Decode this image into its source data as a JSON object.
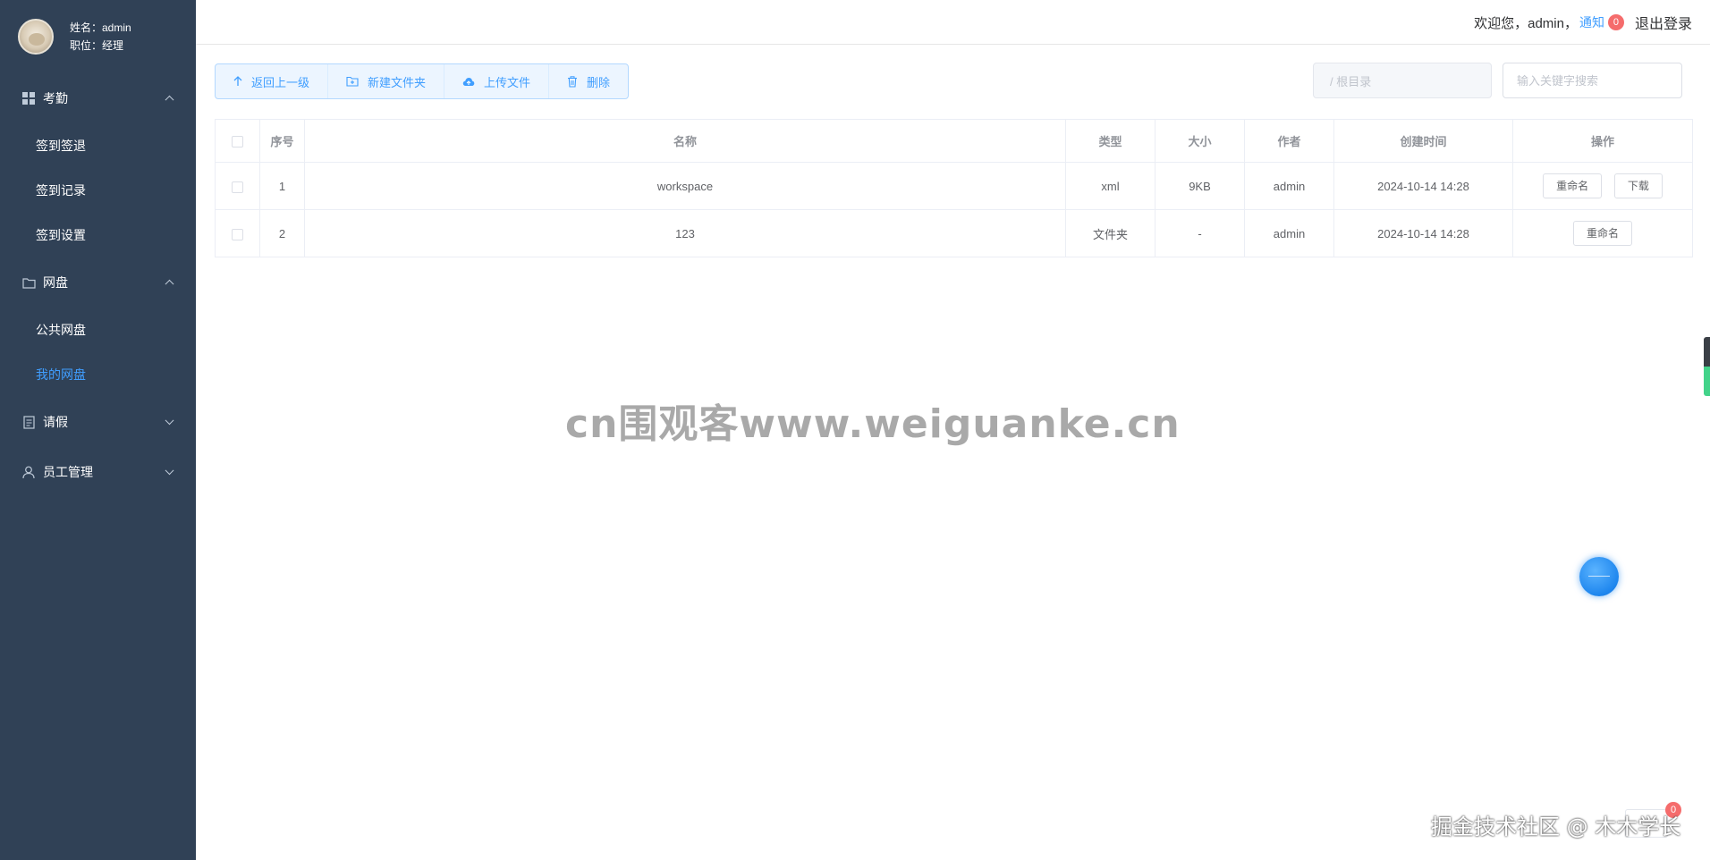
{
  "user": {
    "name_line": "姓名：admin",
    "role_line": "职位：经理"
  },
  "sidebar": {
    "groups": [
      {
        "label": "考勤",
        "icon": "grid-icon",
        "expanded": true,
        "items": [
          "签到签退",
          "签到记录",
          "签到设置"
        ]
      },
      {
        "label": "网盘",
        "icon": "folder-icon",
        "expanded": true,
        "items": [
          "公共网盘",
          "我的网盘"
        ]
      },
      {
        "label": "请假",
        "icon": "document-icon",
        "expanded": false,
        "items": []
      },
      {
        "label": "员工管理",
        "icon": "user-icon",
        "expanded": false,
        "items": []
      }
    ],
    "active_item": "我的网盘",
    "active_color": "#409eff",
    "background": "#304156"
  },
  "header": {
    "welcome": "欢迎您，admin，",
    "notice_label": "通知",
    "notice_count": "0",
    "logout_label": "退出登录"
  },
  "toolbar": {
    "back_label": "返回上一级",
    "new_folder_label": "新建文件夹",
    "upload_label": "上传文件",
    "delete_label": "删除"
  },
  "path": {
    "placeholder": "/ 根目录"
  },
  "search": {
    "placeholder": "输入关键字搜索"
  },
  "table": {
    "headers": [
      "序号",
      "名称",
      "类型",
      "大小",
      "作者",
      "创建时间",
      "操作"
    ],
    "rows": [
      {
        "index": "1",
        "name": "workspace",
        "type": "xml",
        "size": "9KB",
        "author": "admin",
        "created": "2024-10-14 14:28",
        "actions": [
          "重命名",
          "下载"
        ]
      },
      {
        "index": "2",
        "name": "123",
        "type": "文件夹",
        "size": "-",
        "author": "admin",
        "created": "2024-10-14 14:28",
        "actions": [
          "重命名"
        ]
      }
    ]
  },
  "watermarks": {
    "center": "cn围观客www.weiguanke.cn",
    "bottom": "掘金技术社区 @ 木木学长"
  },
  "bottom_badge": "0"
}
